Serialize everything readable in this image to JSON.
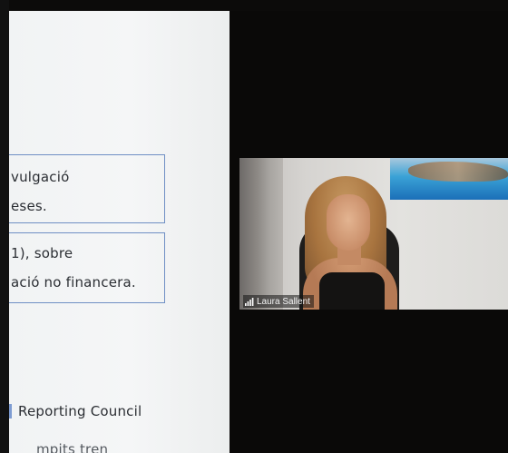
{
  "slide": {
    "lines": [
      "vulgació",
      "eses.",
      "1), sobre",
      "ació no financera.",
      "Reporting Council",
      "mpits tren"
    ]
  },
  "video": {
    "participant_name": "Laura Sallent",
    "signal_icon": "signal-strength-icon"
  },
  "colors": {
    "box_border": "#6f8fc4",
    "background": "#0a0908"
  }
}
